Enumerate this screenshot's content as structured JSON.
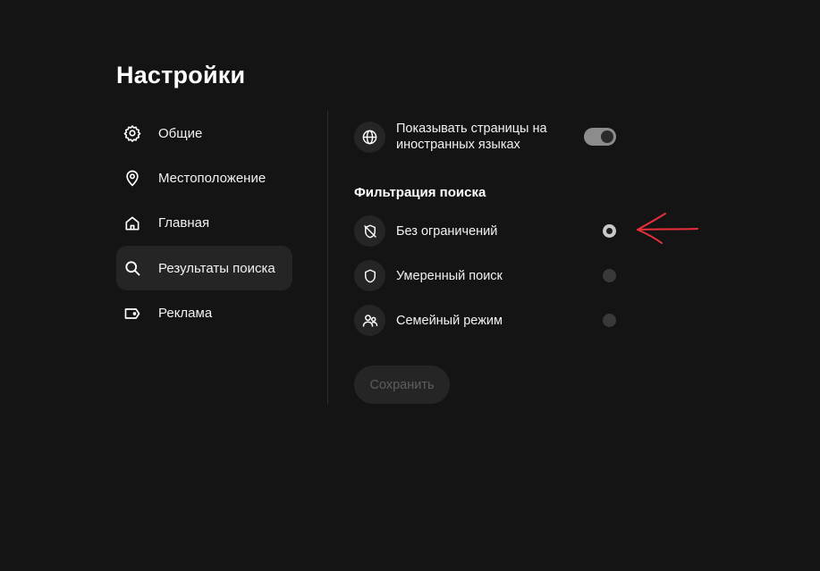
{
  "page": {
    "title": "Настройки"
  },
  "nav": {
    "items": [
      {
        "label": "Общие",
        "icon": "gear-icon"
      },
      {
        "label": "Местоположение",
        "icon": "location-pin-icon"
      },
      {
        "label": "Главная",
        "icon": "home-icon"
      },
      {
        "label": "Результаты поиска",
        "icon": "search-icon",
        "active": true
      },
      {
        "label": "Реклама",
        "icon": "ad-tag-icon"
      }
    ]
  },
  "settings": {
    "foreign_pages": {
      "label": "Показывать страницы на иностранных языках",
      "label_line1": "Показывать страницы на",
      "label_line2": "иностранных языках",
      "icon": "globe-icon",
      "enabled": true
    },
    "filter": {
      "title": "Фильтрация поиска",
      "options": [
        {
          "label": "Без ограничений",
          "icon": "shield-off-icon",
          "selected": true
        },
        {
          "label": "Умеренный поиск",
          "icon": "shield-icon",
          "selected": false
        },
        {
          "label": "Семейный режим",
          "icon": "family-icon",
          "selected": false
        }
      ]
    },
    "save_label": "Сохранить"
  },
  "colors": {
    "background": "#151415",
    "surface": "#262526",
    "annotation_arrow": "#e8303a"
  }
}
